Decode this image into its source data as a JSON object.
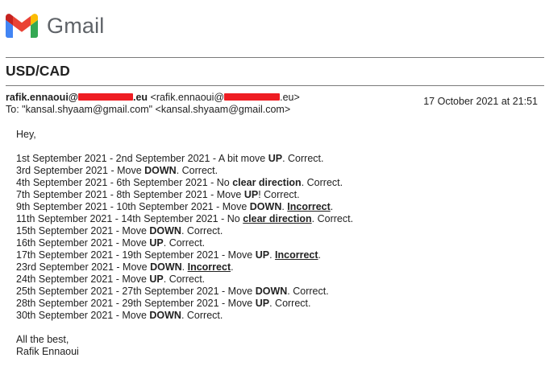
{
  "app": {
    "brand_name": "Gmail"
  },
  "email": {
    "subject": "USD/CAD",
    "from_name_prefix": "rafik.ennaoui@",
    "from_name_suffix": ".eu",
    "from_addr_prefix": "<rafik.ennaoui@",
    "from_addr_suffix": ".eu>",
    "to_line": "To: \"kansal.shyaam@gmail.com\" <kansal.shyaam@gmail.com>",
    "date": "17 October 2021 at 21:51",
    "greeting": "Hey,",
    "lines": [
      {
        "pre": "1st September 2021 - 2nd September 2021 - A bit move ",
        "emph": "UP",
        "post": ". Correct.",
        "underline": false
      },
      {
        "pre": "3rd September 2021 - Move ",
        "emph": "DOWN",
        "post": ". Correct.",
        "underline": false
      },
      {
        "pre": "4th September 2021 - 6th September 2021 - No ",
        "emph": "clear direction",
        "post": ". Correct.",
        "underline": false
      },
      {
        "pre": "7th September 2021 - 8th September 2021 - Move ",
        "emph": "UP",
        "post": "! Correct.",
        "underline": false
      },
      {
        "pre": "9th September 2021 - 10th September 2021 - Move ",
        "emph": "DOWN",
        "mid": ". ",
        "emph2": "Incorrect",
        "post": ".",
        "underline": false,
        "underline2": true
      },
      {
        "pre": "11th September 2021 - 14th September 2021 - No ",
        "emph": "clear direction",
        "post": ". Correct.",
        "underline": true
      },
      {
        "pre": "15th September 2021 - Move ",
        "emph": "DOWN",
        "post": ". Correct.",
        "underline": false
      },
      {
        "pre": "16th September 2021 - Move ",
        "emph": "UP",
        "post": ". Correct.",
        "underline": false
      },
      {
        "pre": "17th September 2021 - 19th September 2021 - Move ",
        "emph": "UP",
        "mid": ". ",
        "emph2": "Incorrect",
        "post": ".",
        "underline": false,
        "underline2": true
      },
      {
        "pre": "23rd September 2021 - Move ",
        "emph": "DOWN",
        "mid": ". ",
        "emph2": "Incorrect",
        "post": ".",
        "underline": false,
        "underline2": true
      },
      {
        "pre": "24th September 2021 - Move ",
        "emph": "UP",
        "post": ". Correct.",
        "underline": false
      },
      {
        "pre": "25th September 2021 - 27th September 2021 - Move ",
        "emph": "DOWN",
        "post": ". Correct.",
        "underline": false
      },
      {
        "pre": "28th September 2021 - 29th September 2021 - Move ",
        "emph": "UP",
        "post": ". Correct.",
        "underline": false
      },
      {
        "pre": "30th September 2021 - Move ",
        "emph": "DOWN",
        "post": ". Correct.",
        "underline": false
      }
    ],
    "signoff": "All the best,",
    "signature": "Rafik Ennaoui"
  },
  "colors": {
    "redaction": "#ee1d23",
    "logo_blue": "#4285f4",
    "logo_green": "#34a853",
    "logo_yellow": "#fbbc04",
    "logo_red": "#ea4335",
    "logo_darkred": "#c5221f"
  },
  "icons": {
    "logo": "gmail-m-logo"
  }
}
